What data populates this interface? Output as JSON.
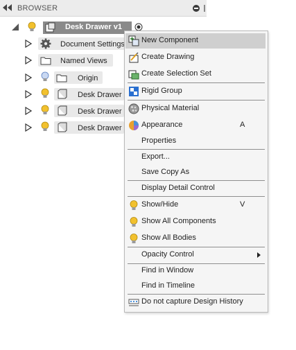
{
  "browser": {
    "title": "BROWSER"
  },
  "tree": {
    "root": {
      "label": "Desk Drawer v1"
    },
    "items": [
      {
        "label": "Document Settings",
        "icon": "gear-icon"
      },
      {
        "label": "Named Views",
        "icon": "folder-icon"
      },
      {
        "label": "Origin",
        "icon": "folder-icon"
      },
      {
        "label": "Desk Drawer",
        "icon": "component-icon"
      },
      {
        "label": "Desk Drawer",
        "icon": "component-icon"
      },
      {
        "label": "Desk Drawer",
        "icon": "component-icon"
      }
    ]
  },
  "menu": {
    "items": [
      {
        "label": "New Component",
        "icon": "new-component-icon",
        "shortcut": ""
      },
      {
        "label": "Create Drawing",
        "icon": "create-drawing-icon",
        "shortcut": ""
      },
      {
        "label": "Create Selection Set",
        "icon": "selection-set-icon",
        "shortcut": ""
      },
      {
        "label": "Rigid Group",
        "icon": "rigid-group-icon",
        "shortcut": ""
      },
      {
        "label": "Physical Material",
        "icon": "physical-material-icon",
        "shortcut": ""
      },
      {
        "label": "Appearance",
        "icon": "appearance-icon",
        "shortcut": "A"
      },
      {
        "label": "Properties",
        "icon": "",
        "shortcut": ""
      },
      {
        "label": "Export...",
        "icon": "",
        "shortcut": ""
      },
      {
        "label": "Save Copy As",
        "icon": "",
        "shortcut": ""
      },
      {
        "label": "Display Detail Control",
        "icon": "",
        "shortcut": ""
      },
      {
        "label": "Show/Hide",
        "icon": "lightbulb-icon",
        "shortcut": "V"
      },
      {
        "label": "Show All Components",
        "icon": "lightbulb-icon",
        "shortcut": ""
      },
      {
        "label": "Show All Bodies",
        "icon": "lightbulb-icon",
        "shortcut": ""
      },
      {
        "label": "Opacity Control",
        "icon": "",
        "shortcut": ""
      },
      {
        "label": "Find in Window",
        "icon": "",
        "shortcut": ""
      },
      {
        "label": "Find in Timeline",
        "icon": "",
        "shortcut": ""
      },
      {
        "label": "Do not capture Design History",
        "icon": "design-history-icon",
        "shortcut": ""
      }
    ]
  },
  "colors": {
    "bulb_yellow": "#f2c12e",
    "bulb_blue": "#8fb0e0",
    "menu_hover": "#cfcfcf",
    "root_highlight": "#8a8a8a"
  }
}
